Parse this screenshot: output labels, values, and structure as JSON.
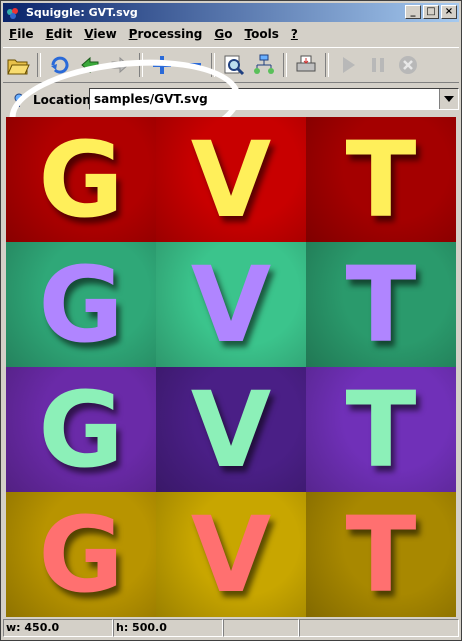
{
  "window": {
    "title": "Squiggle: GVT.svg"
  },
  "menu": [
    {
      "label": "File",
      "key": "F",
      "rest": "ile"
    },
    {
      "label": "Edit",
      "key": "E",
      "rest": "dit"
    },
    {
      "label": "View",
      "key": "V",
      "rest": "iew"
    },
    {
      "label": "Processing",
      "key": "P",
      "rest": "rocessing"
    },
    {
      "label": "Go",
      "key": "G",
      "rest": "o"
    },
    {
      "label": "Tools",
      "key": "T",
      "rest": "ools"
    },
    {
      "label": "?",
      "key": "?",
      "rest": ""
    }
  ],
  "toolbar": {
    "icons": [
      "open-folder-icon",
      "reload-icon",
      "back-icon",
      "forward-icon",
      "zoom-in-icon",
      "zoom-out-icon",
      "magnifier-icon",
      "dom-tree-icon",
      "print-icon",
      "play-icon",
      "pause-icon",
      "stop-icon"
    ]
  },
  "location": {
    "label": "Location:",
    "value": "samples/GVT.svg"
  },
  "canvas": {
    "rows": [
      {
        "letters": [
          "G",
          "V",
          "T"
        ],
        "bg": [
          "#b00000",
          "#c80000",
          "#a40000"
        ],
        "fg": "#ffef5a"
      },
      {
        "letters": [
          "G",
          "V",
          "T"
        ],
        "bg": [
          "#2fa878",
          "#3bc48c",
          "#2a9a6c"
        ],
        "fg": "#b085ff"
      },
      {
        "letters": [
          "G",
          "V",
          "T"
        ],
        "bg": [
          "#6a2aa8",
          "#4a1f86",
          "#7030b8"
        ],
        "fg": "#8cf0b8"
      },
      {
        "letters": [
          "G",
          "V",
          "T"
        ],
        "bg": [
          "#b89400",
          "#c8a600",
          "#a88800"
        ],
        "fg": "#ff7070"
      }
    ]
  },
  "status": {
    "width": "w: 450.0",
    "height": "h: 500.0"
  },
  "colors": {
    "title_start": "#0a246a",
    "title_end": "#a6caf0",
    "chrome": "#d4d0c8"
  }
}
